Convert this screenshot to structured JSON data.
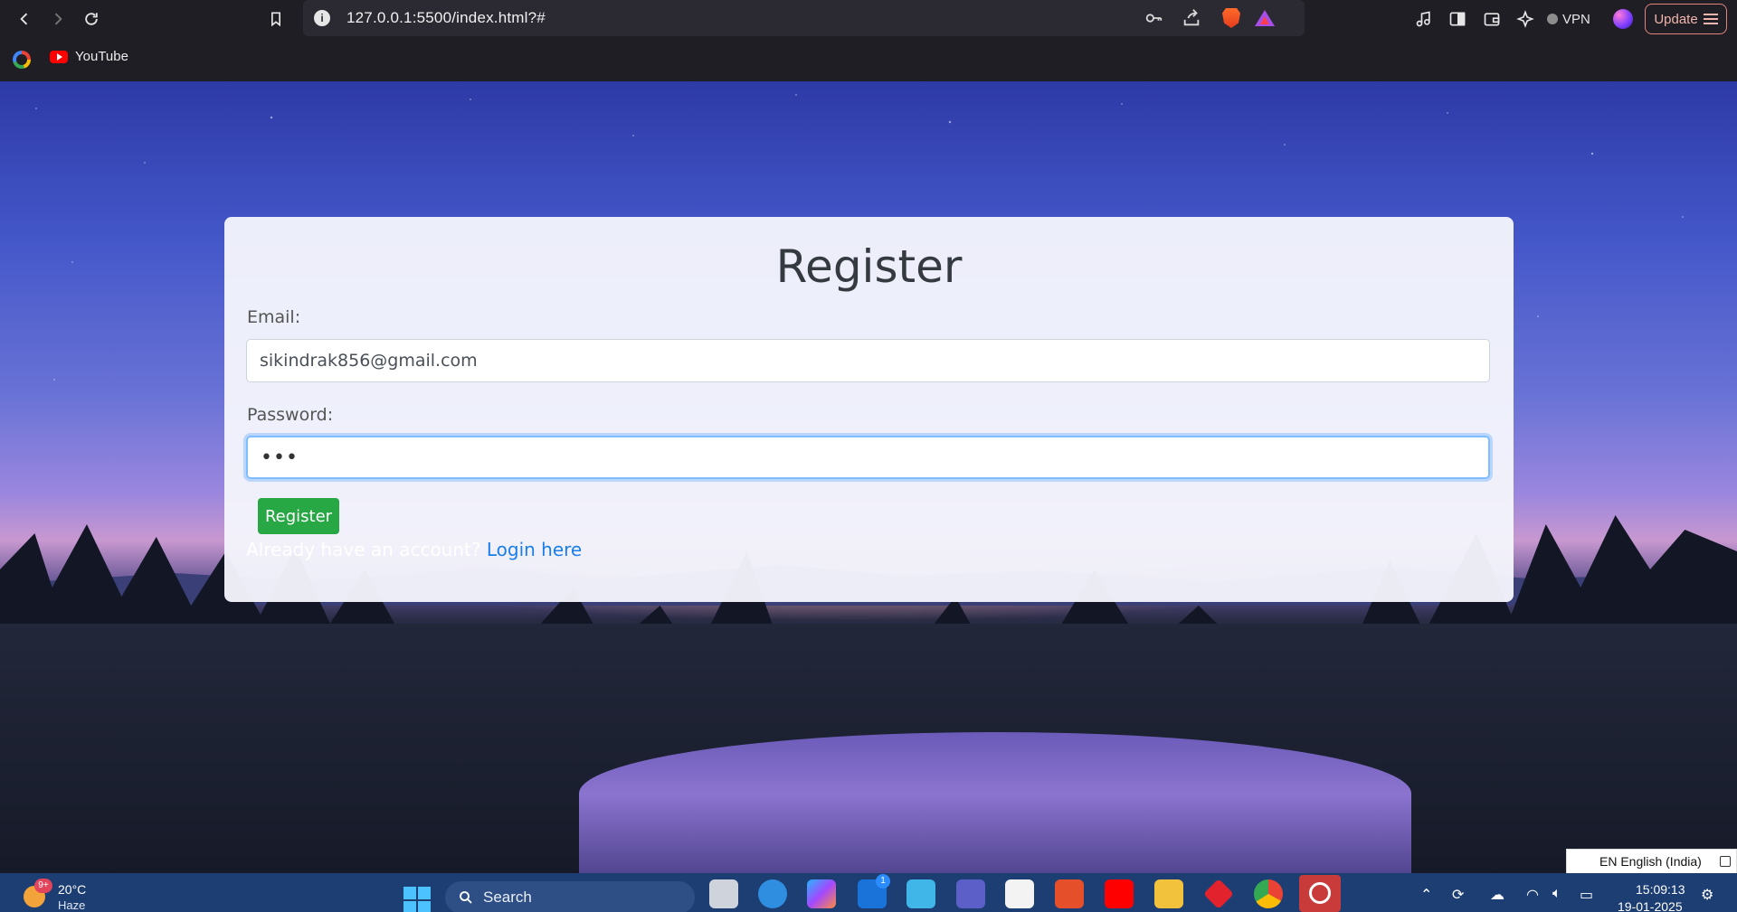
{
  "browser": {
    "url": "127.0.0.1:5500/index.html?#",
    "vpn_label": "VPN",
    "update_label": "Update"
  },
  "bookmarks": {
    "youtube_label": "YouTube"
  },
  "form": {
    "title": "Register",
    "email_label": "Email:",
    "email_value": "sikindrak856@gmail.com",
    "password_label": "Password:",
    "password_value": "•••",
    "submit_label": "Register",
    "already_text": "Already have an account? ",
    "login_link": "Login here"
  },
  "language": {
    "label": "EN English (India)"
  },
  "taskbar": {
    "weather_temp": "20°C",
    "weather_cond": "Haze",
    "weather_badge": "9+",
    "search_label": "Search",
    "time": "15:09:13",
    "date": "19-01-2025",
    "outlook_badge": "1"
  },
  "colors": {
    "accent_green": "#28a745",
    "link_blue": "#1a7fe8",
    "focus_blue": "#80bdff",
    "taskbar": "#1d3e73"
  }
}
